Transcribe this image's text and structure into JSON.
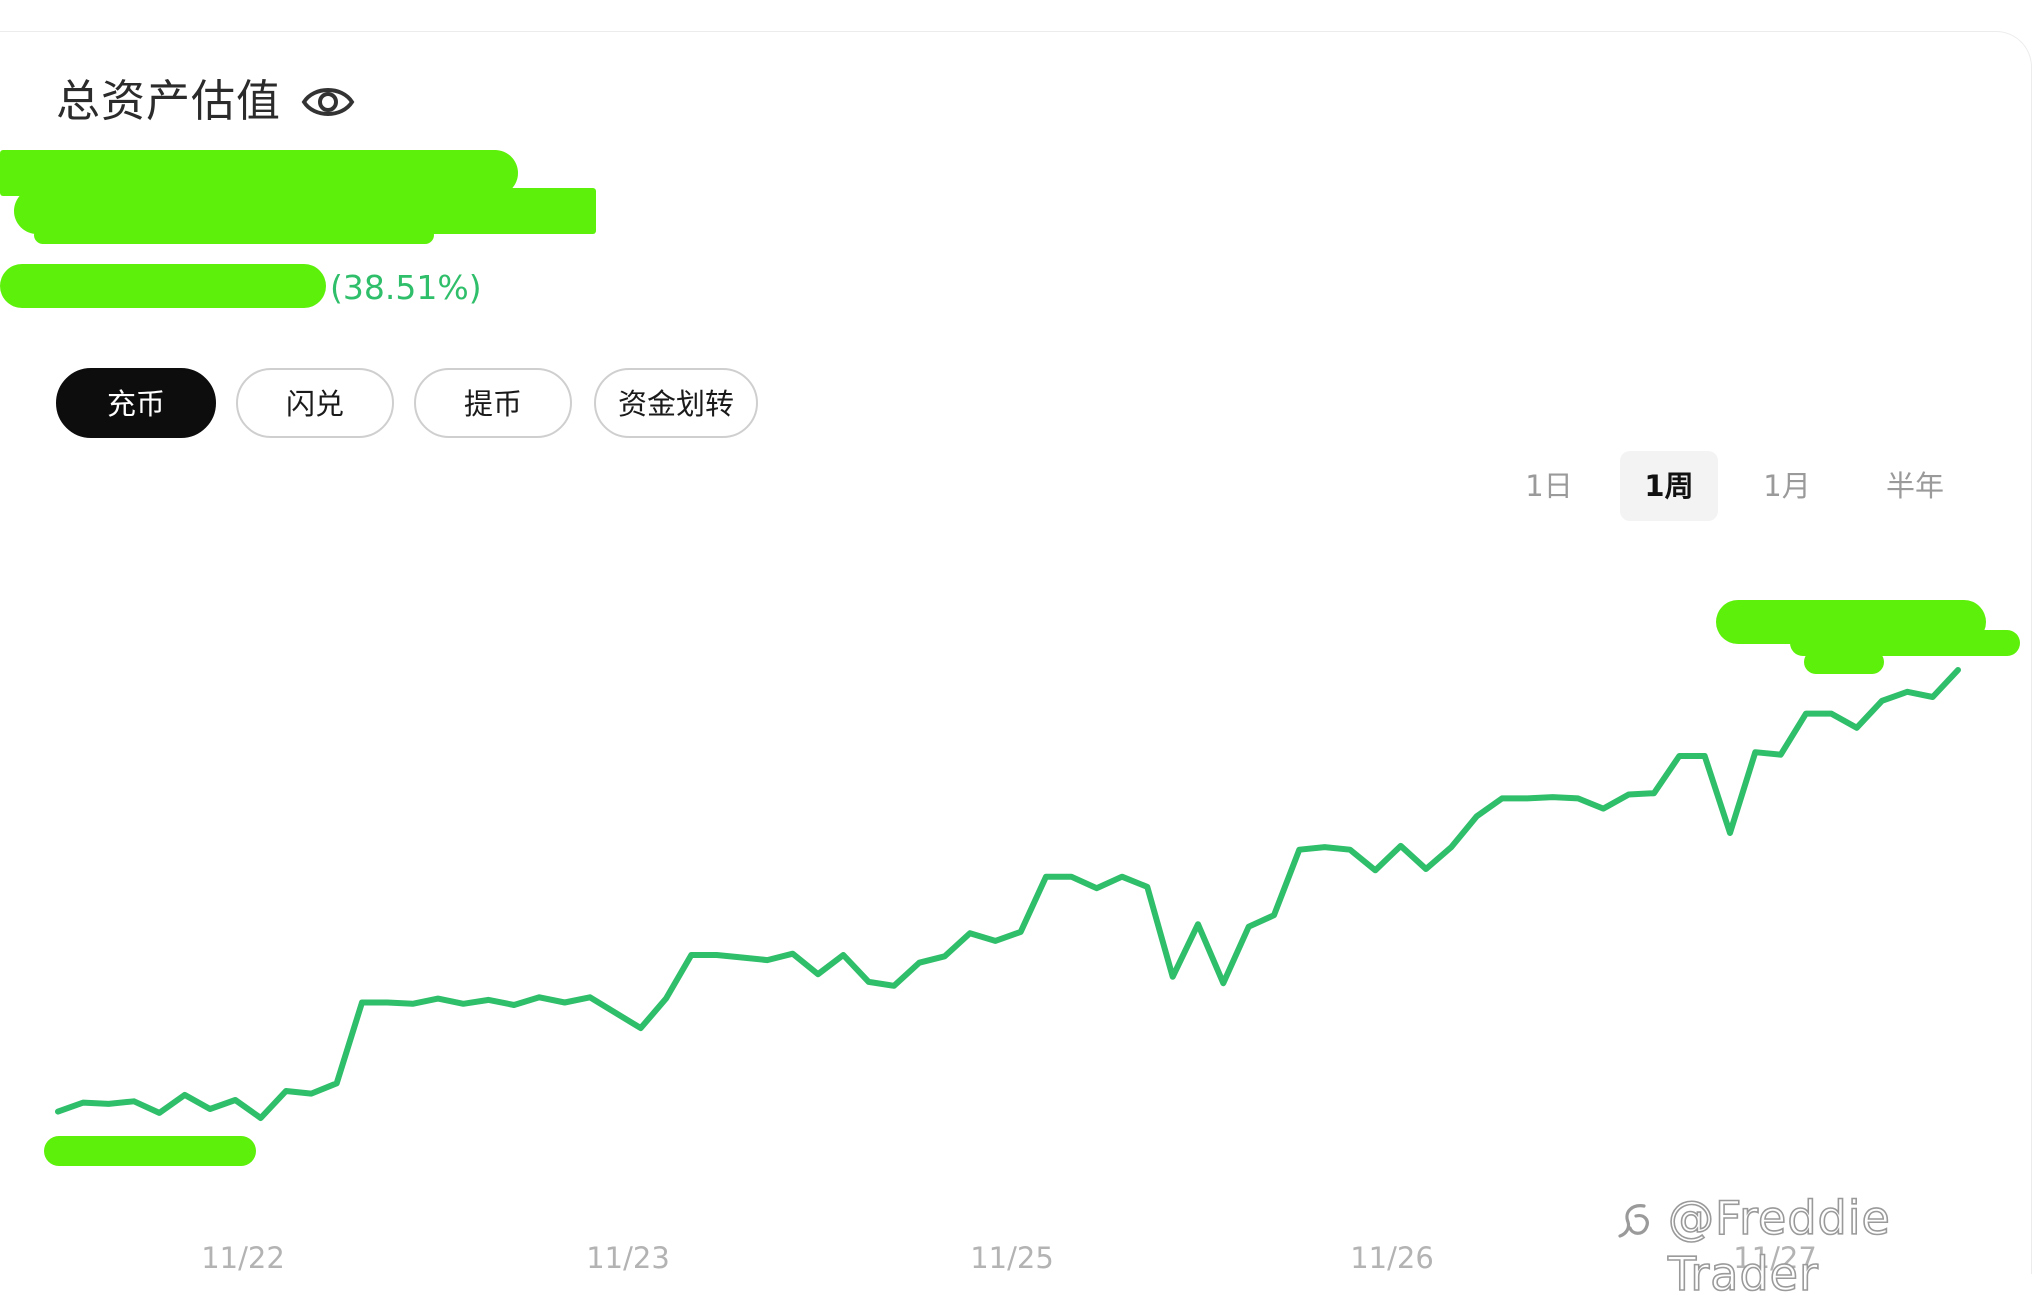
{
  "header": {
    "title": "总资产估值",
    "eye_icon": "eye-icon",
    "pnl_percent": "(38.51%)"
  },
  "actions": [
    {
      "label": "充币",
      "primary": true
    },
    {
      "label": "闪兑",
      "primary": false
    },
    {
      "label": "提币",
      "primary": false
    },
    {
      "label": "资金划转",
      "primary": false
    }
  ],
  "ranges": [
    {
      "label": "1日",
      "active": false
    },
    {
      "label": "1周",
      "active": true
    },
    {
      "label": "1月",
      "active": false
    },
    {
      "label": "半年",
      "active": false
    }
  ],
  "watermark": {
    "text": "@Freddie Trader",
    "icon": "weibo-logo-icon"
  },
  "colors": {
    "line": "#2fbe6a",
    "redaction": "#5df00a",
    "primary_button": "#0d0d0d"
  },
  "chart_data": {
    "type": "line",
    "x_ticks": [
      "11/22",
      "11/23",
      "11/25",
      "11/26",
      "11/27"
    ],
    "y_axis_labels_visible": false,
    "grid": false,
    "series": [
      {
        "values": [
          0.0,
          1.4,
          1.2,
          1.6,
          -0.2,
          2.6,
          0.4,
          1.8,
          -1.0,
          3.2,
          2.8,
          4.4,
          17.0,
          17.0,
          16.8,
          17.6,
          16.8,
          17.4,
          16.6,
          17.8,
          17.0,
          17.8,
          15.4,
          13.0,
          17.6,
          24.4,
          24.4,
          24.0,
          23.6,
          24.6,
          21.4,
          24.4,
          20.2,
          19.6,
          23.2,
          24.2,
          27.8,
          26.6,
          28.0,
          36.6,
          36.6,
          34.8,
          36.6,
          35.0,
          21.0,
          29.2,
          20.0,
          28.8,
          30.6,
          40.8,
          41.2,
          40.8,
          37.6,
          41.4,
          37.8,
          41.2,
          46.0,
          48.8,
          48.8,
          49.0,
          48.8,
          47.2,
          49.4,
          49.6,
          55.4,
          55.4,
          43.4,
          56.0,
          55.6,
          62.0,
          62.0,
          59.8,
          64.0,
          65.4,
          64.6,
          68.8
        ]
      }
    ]
  }
}
